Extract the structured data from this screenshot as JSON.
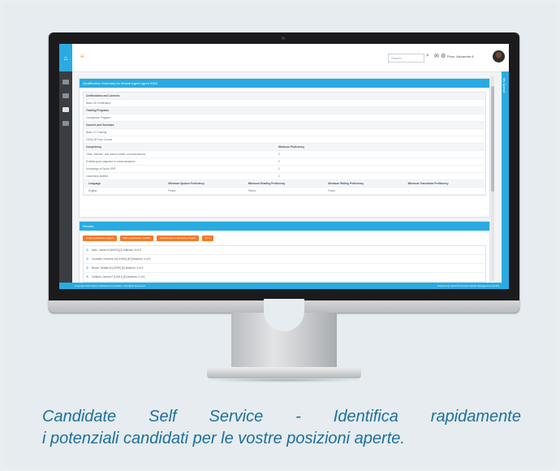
{
  "app": {
    "search_placeholder": "Search",
    "user_name": "Price, Alexandre A",
    "right_tab_label": "My Queue"
  },
  "panel1": {
    "title": "Qualification Summary for Mutual Agent Agent ISSA",
    "sections": [
      {
        "heading": "Certifications and Licenses",
        "rows": [
          "Basic Lift Certification"
        ]
      },
      {
        "heading": "Training Programs",
        "rows": [
          "Compliance Program"
        ]
      },
      {
        "heading": "Courses and Seminars",
        "rows": [
          "Basic JIT Training",
          "OSHA 30 Hour Course"
        ]
      }
    ],
    "competency": {
      "heading": "Competency",
      "heading2": "Minimum Proficiency",
      "rows": [
        {
          "name": "Clear, effective, and correct written communications",
          "level": "2"
        },
        {
          "name": "Exhibits good judgment in communications",
          "level": "2"
        },
        {
          "name": "Knowledge of Epicor ERP",
          "level": "2"
        },
        {
          "name": "Leadership abilities",
          "level": "2"
        }
      ]
    },
    "language": {
      "headers": [
        "Language",
        "Minimum Spoken Proficiency",
        "Minimum Reading Proficiency",
        "Minimum Writing Proficiency",
        "Minimum Translation Proficiency"
      ],
      "row": [
        "English",
        "Fluent",
        "Fluent",
        "Fluent",
        "-"
      ]
    }
  },
  "panel2": {
    "title": "Results",
    "buttons": [
      "Notify Qualification Agent",
      "New Qualification Search",
      "Add Results to Workshop Project",
      "Print"
    ],
    "results": [
      "Allen, James M [A0023] [2] Matches: 5 of 9",
      "Chandler, Kimberly M [CH003] [E2] Matches: 4 of 9",
      "Brown, Debbie M [10780] [E] Matches: 3 of 9",
      "Childers, Dennis P [L0001] [E] Matches: 2 of 9"
    ]
  },
  "footer": {
    "left": "Copyright 2017 Epicor Software Corporation. All Rights Reserved.",
    "right": "Powered by Epicor® Human Capital Management (HCM)"
  },
  "caption": {
    "line1_words": [
      "Candidate",
      "Self",
      "Service",
      "-",
      "Identifica",
      "rapidamente"
    ],
    "line2": "i potenziali candidati per le vostre posizioni aperte."
  }
}
